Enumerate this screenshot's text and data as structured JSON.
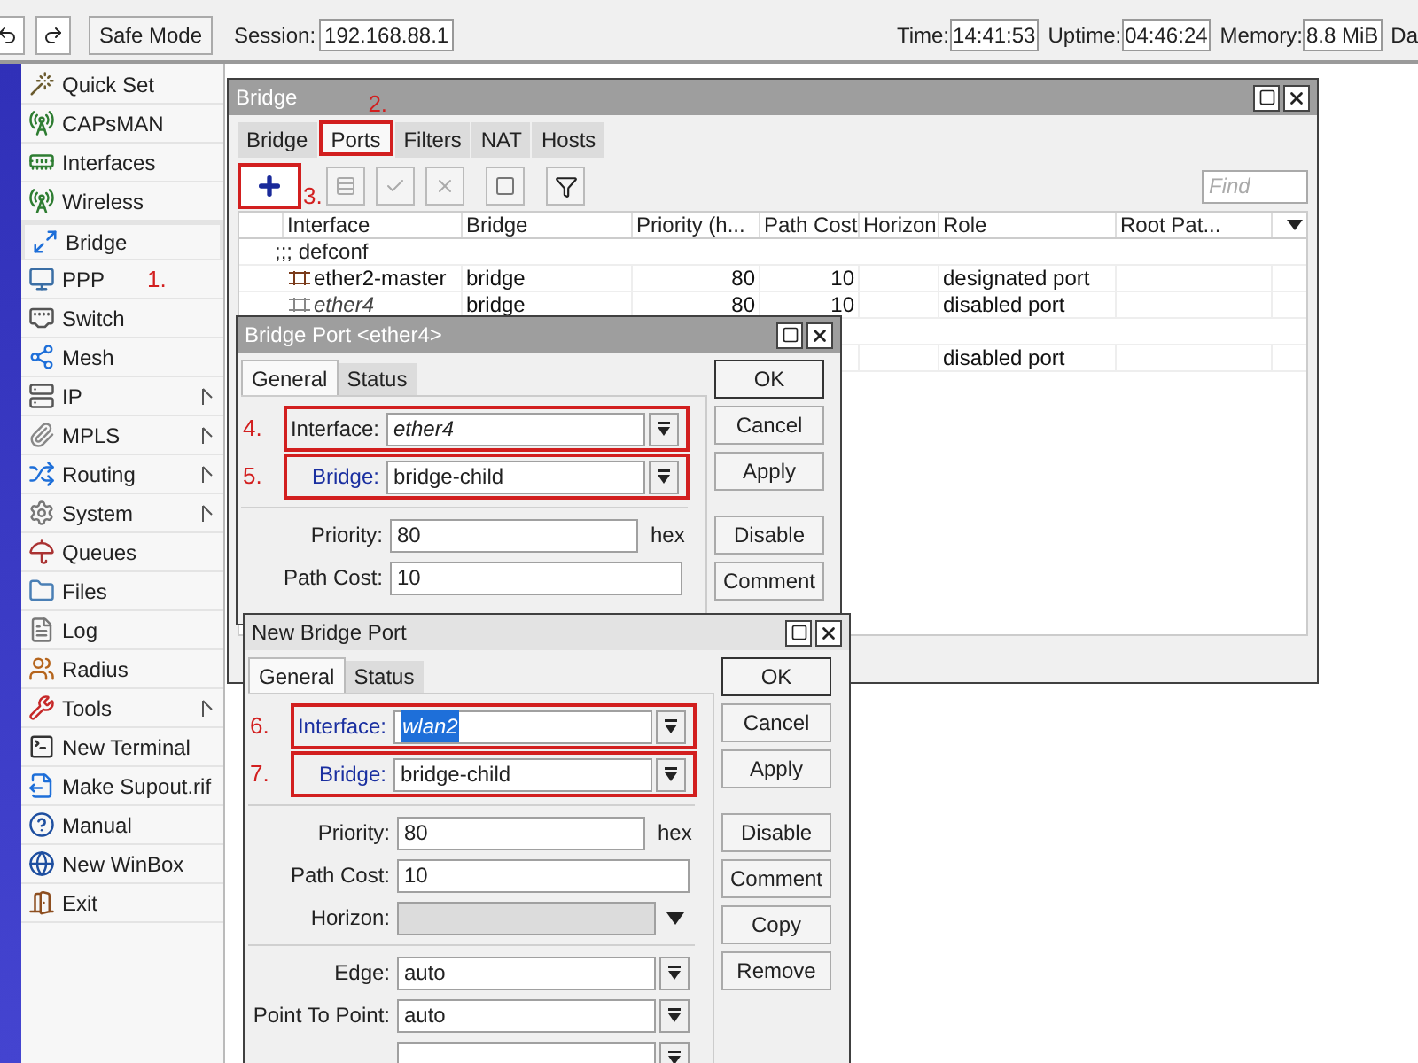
{
  "toolbar": {
    "safe_mode": "Safe Mode",
    "session_label": "Session:",
    "session": "192.168.88.1",
    "stats": [
      {
        "label": "Time:",
        "value": "14:41:53"
      },
      {
        "label": "Uptime:",
        "value": "04:46:24"
      },
      {
        "label": "Memory:",
        "value": "8.8 MiB"
      }
    ],
    "cut_label": "Da"
  },
  "menu": [
    {
      "label": "Quick Set",
      "submenu": false
    },
    {
      "label": "CAPsMAN",
      "submenu": false
    },
    {
      "label": "Interfaces",
      "submenu": false
    },
    {
      "label": "Wireless",
      "submenu": false
    },
    {
      "label": "Bridge",
      "submenu": false,
      "marker": "1."
    },
    {
      "label": "PPP",
      "submenu": false
    },
    {
      "label": "Switch",
      "submenu": false
    },
    {
      "label": "Mesh",
      "submenu": false
    },
    {
      "label": "IP",
      "submenu": true
    },
    {
      "label": "MPLS",
      "submenu": true
    },
    {
      "label": "Routing",
      "submenu": true
    },
    {
      "label": "System",
      "submenu": true
    },
    {
      "label": "Queues",
      "submenu": false
    },
    {
      "label": "Files",
      "submenu": false
    },
    {
      "label": "Log",
      "submenu": false
    },
    {
      "label": "Radius",
      "submenu": false
    },
    {
      "label": "Tools",
      "submenu": true
    },
    {
      "label": "New Terminal",
      "submenu": false
    },
    {
      "label": "Make Supout.rif",
      "submenu": false
    },
    {
      "label": "Manual",
      "submenu": false
    },
    {
      "label": "New WinBox",
      "submenu": false
    },
    {
      "label": "Exit",
      "submenu": false
    }
  ],
  "bridge_window": {
    "title": "Bridge",
    "tabs": [
      {
        "label": "Bridge",
        "selected": false
      },
      {
        "label": "Ports",
        "selected": true,
        "marker": "2."
      },
      {
        "label": "Filters",
        "selected": false
      },
      {
        "label": "NAT",
        "selected": false
      },
      {
        "label": "Hosts",
        "selected": false
      }
    ],
    "add_marker": "3.",
    "find_placeholder": "Find",
    "columns": [
      "Interface",
      "Bridge",
      "Priority (h...",
      "Path Cost",
      "Horizon",
      "Role",
      "Root Pat..."
    ],
    "rows": [
      {
        "kind": "comment",
        "text": ";;; defconf"
      },
      {
        "kind": "port",
        "interface": "ether2-master",
        "disabled": false,
        "bridge": "bridge",
        "priority": "80",
        "path_cost": "10",
        "role": "designated port"
      },
      {
        "kind": "port",
        "interface": "ether4",
        "disabled": true,
        "bridge": "bridge",
        "priority": "80",
        "path_cost": "10",
        "role": "disabled port"
      },
      {
        "kind": "blank"
      },
      {
        "kind": "port",
        "role": "disabled port"
      }
    ]
  },
  "dialogs": [
    {
      "title": "Bridge Port <ether4>",
      "active": false,
      "tabs": [
        {
          "label": "General",
          "selected": true
        },
        {
          "label": "Status",
          "selected": false
        }
      ],
      "fields": [
        {
          "kind": "select",
          "label": "Interface:",
          "value": "ether4",
          "italic": true,
          "changed": false,
          "highlighted": false,
          "marker": "4."
        },
        {
          "kind": "select",
          "label": "Bridge:",
          "value": "bridge-child",
          "italic": false,
          "changed": true,
          "highlighted": false,
          "marker": "5."
        },
        {
          "kind": "divider"
        },
        {
          "kind": "text",
          "label": "Priority:",
          "value": "80",
          "unit": "hex"
        },
        {
          "kind": "text",
          "label": "Path Cost:",
          "value": "10"
        }
      ],
      "buttons": [
        "OK",
        "Cancel",
        "Apply",
        "Disable",
        "Comment"
      ]
    },
    {
      "title": "New Bridge Port",
      "active": true,
      "tabs": [
        {
          "label": "General",
          "selected": true
        },
        {
          "label": "Status",
          "selected": false
        }
      ],
      "fields": [
        {
          "kind": "select",
          "label": "Interface:",
          "value": "wlan2",
          "italic": true,
          "changed": true,
          "highlighted": true,
          "marker": "6."
        },
        {
          "kind": "select",
          "label": "Bridge:",
          "value": "bridge-child",
          "italic": false,
          "changed": true,
          "highlighted": false,
          "marker": "7."
        },
        {
          "kind": "divider"
        },
        {
          "kind": "text",
          "label": "Priority:",
          "value": "80",
          "unit": "hex"
        },
        {
          "kind": "text",
          "label": "Path Cost:",
          "value": "10"
        },
        {
          "kind": "combo",
          "label": "Horizon:"
        },
        {
          "kind": "divider"
        },
        {
          "kind": "select",
          "label": "Edge:",
          "value": "auto",
          "italic": false,
          "changed": false,
          "highlighted": false
        },
        {
          "kind": "select",
          "label": "Point To Point:",
          "value": "auto",
          "italic": false,
          "changed": false,
          "highlighted": false
        },
        {
          "kind": "select"
        }
      ],
      "buttons": [
        "OK",
        "Cancel",
        "Apply",
        "Disable",
        "Comment",
        "Copy",
        "Remove"
      ]
    }
  ]
}
